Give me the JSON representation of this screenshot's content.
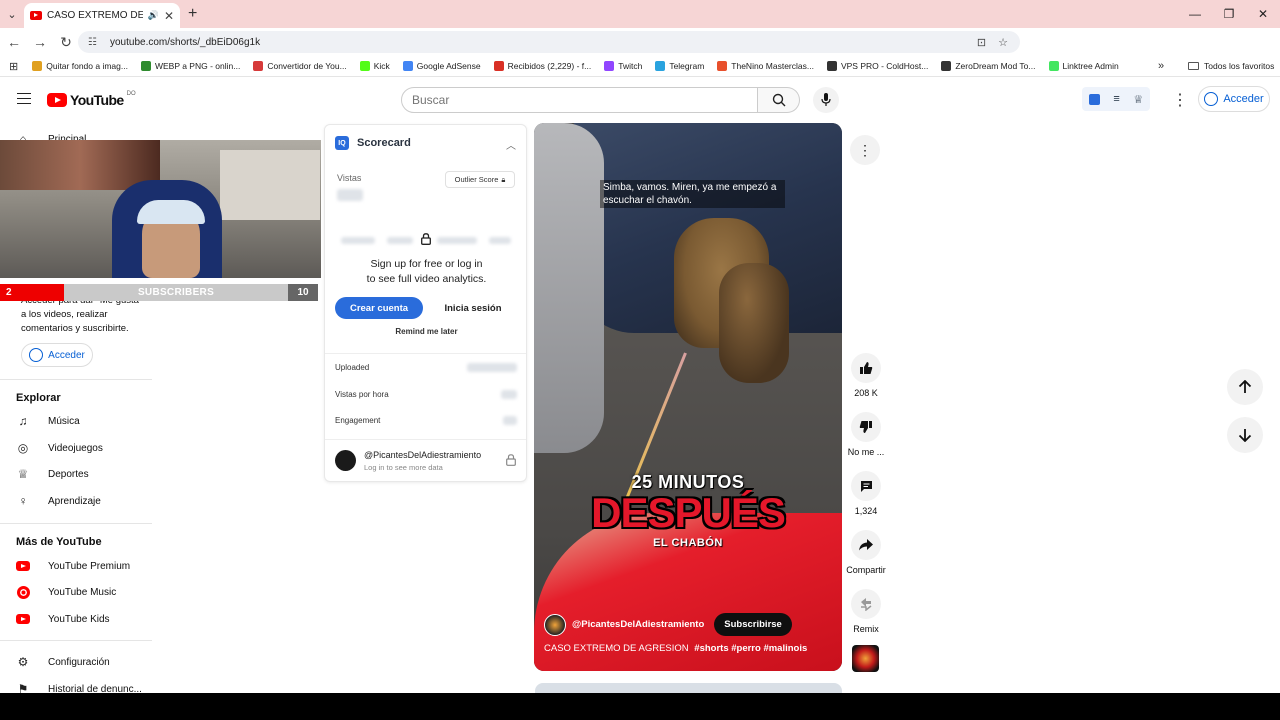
{
  "browser": {
    "tab_title": "CASO EXTREMO DE AGRESIO",
    "url": "youtube.com/shorts/_dbEiD06g1k",
    "bookmarks": [
      {
        "label": "Quitar fondo a imag...",
        "color": "#e0a020"
      },
      {
        "label": "WEBP a PNG - onlin...",
        "color": "#2e8b2e"
      },
      {
        "label": "Convertidor de You...",
        "color": "#d63a3a"
      },
      {
        "label": "Kick",
        "color": "#53fc18"
      },
      {
        "label": "Google AdSense",
        "color": "#4285f4"
      },
      {
        "label": "Recibidos (2,229) - f...",
        "color": "#d93025"
      },
      {
        "label": "Twitch",
        "color": "#9146ff"
      },
      {
        "label": "Telegram",
        "color": "#2aa3df"
      },
      {
        "label": "TheNino Masterclas...",
        "color": "#e8502c"
      },
      {
        "label": "VPS PRO - ColdHost...",
        "color": "#333333"
      },
      {
        "label": "ZeroDream Mod To...",
        "color": "#333333"
      },
      {
        "label": "Linktree Admin",
        "color": "#43e660"
      }
    ],
    "all_bookmarks": "Todos los favoritos"
  },
  "youtube": {
    "logo_text": "YouTube",
    "country_code": "DO",
    "search_placeholder": "Buscar",
    "sign_in": "Acceder"
  },
  "sidebar": {
    "home": "Principal",
    "signin_prompt": "Acceder para dar \"Me gusta\" a los videos, realizar comentarios y suscribirte.",
    "signin_button": "Acceder",
    "explore_heading": "Explorar",
    "explore": [
      "Música",
      "Videojuegos",
      "Deportes",
      "Aprendizaje"
    ],
    "more_heading": "Más de YouTube",
    "more": [
      "YouTube Premium",
      "YouTube Music",
      "YouTube Kids"
    ],
    "settings": "Configuración",
    "report_history": "Historial de denunc..."
  },
  "overlay": {
    "left_count": "2",
    "label": "SUBSCRIBERS",
    "right_count": "10"
  },
  "scorecard": {
    "title": "Scorecard",
    "views_label": "Vistas",
    "outlier_label": "Outlier Score",
    "signup_line1": "Sign up for free or log in",
    "signup_line2": "to see full video analytics.",
    "create_account": "Crear cuenta",
    "login": "Inicia sesión",
    "remind": "Remind me later",
    "rows": [
      "Uploaded",
      "Vistas por hora",
      "Engagement"
    ],
    "channel": "@PicantesDelAdiestramiento",
    "channel_sub": "Log in to see more data"
  },
  "video": {
    "caption": "Simba, vamos. Miren, ya me empezó a escuchar el chavón.",
    "overlay_line1": "25 MINUTOS",
    "overlay_line2": "DESPUÉS",
    "overlay_line3": "EL CHABÓN",
    "channel": "@PicantesDelAdiestramiento",
    "subscribe": "Subscribirse",
    "title": "CASO EXTREMO DE AGRESION",
    "hashtags": "#shorts #perro #malinois"
  },
  "actions": {
    "likes": "208 K",
    "dislike": "No me ...",
    "comments": "1,324",
    "share": "Compartir",
    "remix": "Remix"
  }
}
